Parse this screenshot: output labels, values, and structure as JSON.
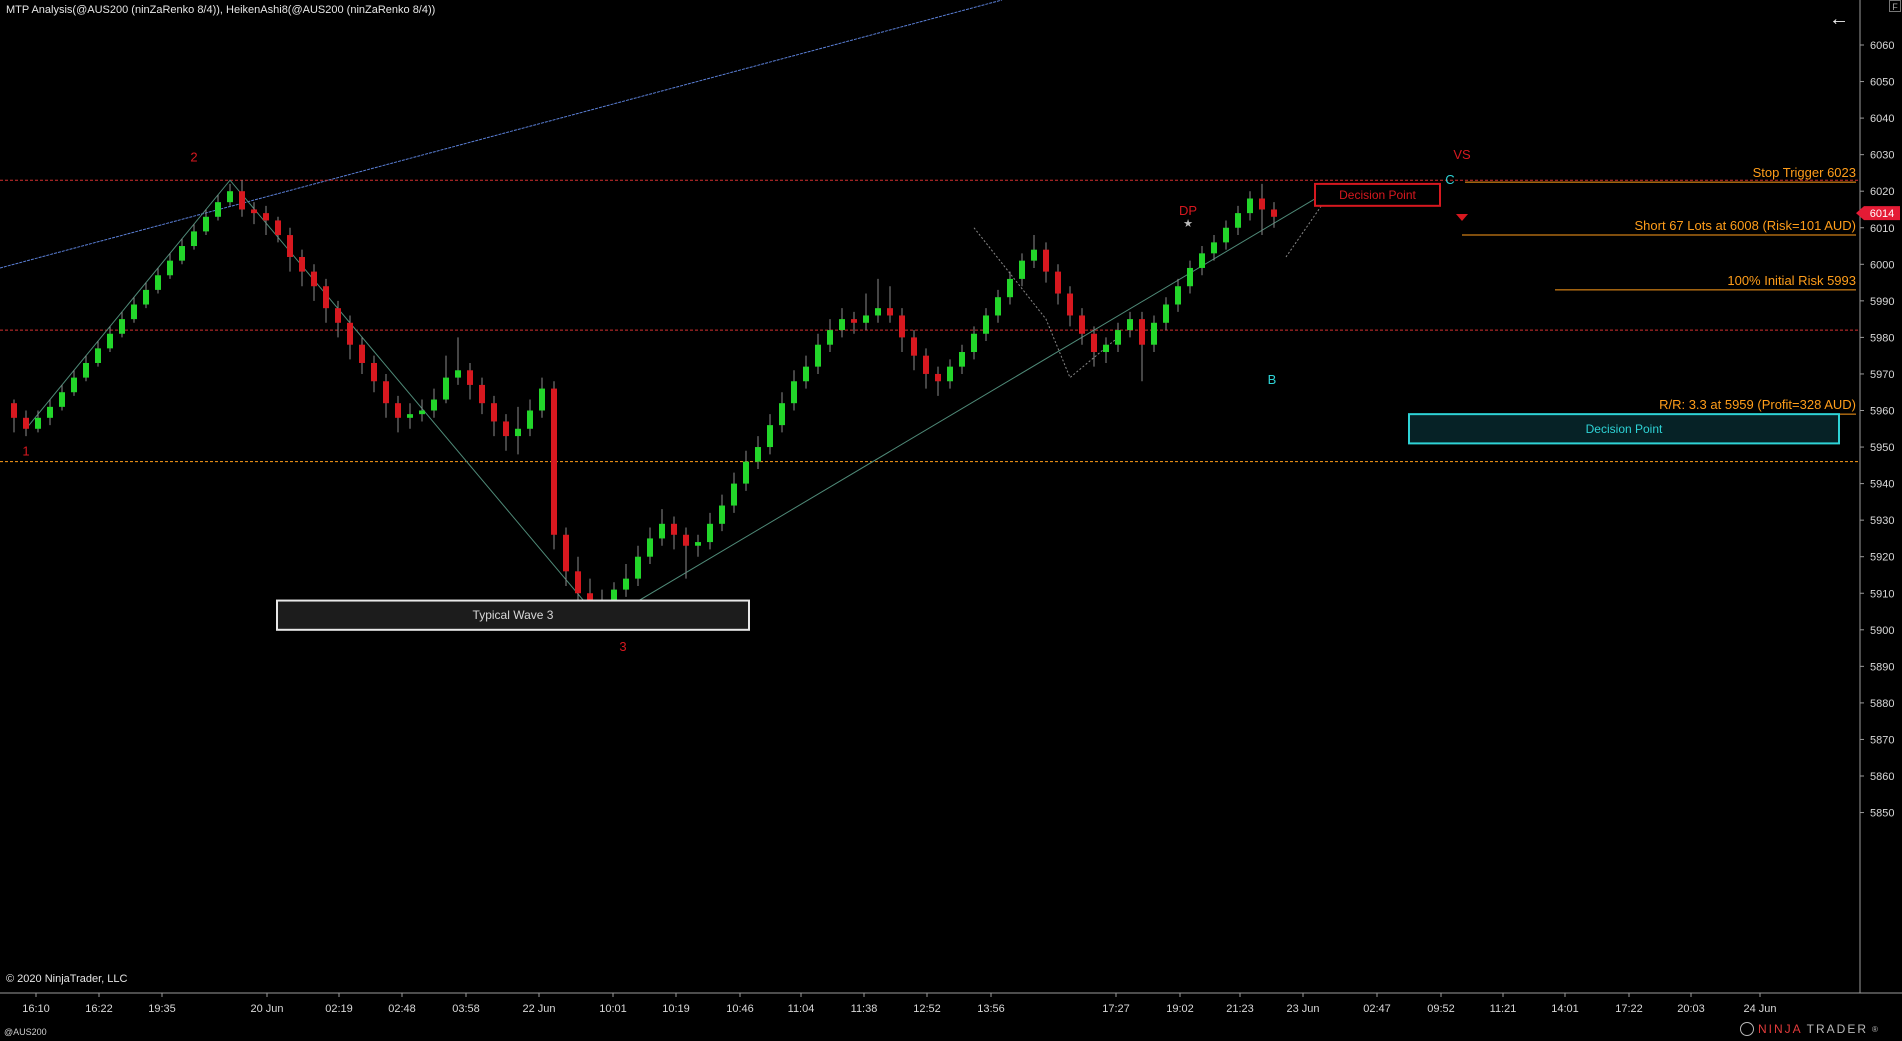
{
  "window": {
    "title": "MTP Analysis(@AUS200 (ninZaRenko 8/4)), HeikenAshi8(@AUS200 (ninZaRenko 8/4))",
    "copyright": "© 2020 NinjaTrader, LLC",
    "instrument": "@AUS200",
    "brand_prefix": "NINJA",
    "brand_suffix": "TRADER",
    "brand_mark": "®",
    "back_icon": "arrow-left-icon",
    "corner_label": "F"
  },
  "colors": {
    "background": "#000000",
    "bull": "#22d62a",
    "bear": "#d7181f",
    "wick": "#8a8a8a",
    "orange": "#ff9d1a",
    "dashed_red": "#d33030",
    "dashed_orange": "#ff9d1a",
    "trendline_blue": "#5a7fd6",
    "wave_line": "#4f8a78",
    "cyan": "#2ed3d6",
    "price_tag": "#e51b35"
  },
  "chart_data": {
    "type": "candlestick",
    "y_axis": {
      "min": 5850,
      "max": 6060,
      "ticks": [
        6060,
        6050,
        6040,
        6030,
        6020,
        6010,
        6000,
        5990,
        5980,
        5970,
        5960,
        5950,
        5940,
        5930,
        5920,
        5910,
        5900,
        5890,
        5880,
        5870,
        5860,
        5850
      ]
    },
    "x_ticks": [
      "16:10",
      "16:22",
      "19:35",
      "20 Jun",
      "02:19",
      "02:48",
      "03:58",
      "22 Jun",
      "10:01",
      "10:19",
      "10:46",
      "11:04",
      "11:38",
      "12:52",
      "13:56",
      "17:27",
      "19:02",
      "21:23",
      "23 Jun",
      "02:47",
      "09:52",
      "11:21",
      "14:01",
      "17:22",
      "20:03",
      "24 Jun"
    ],
    "last_price": "6014",
    "candles": [
      [
        5962,
        5958,
        5963,
        5954
      ],
      [
        5958,
        5955,
        5960,
        5953
      ],
      [
        5955,
        5958,
        5960,
        5954
      ],
      [
        5958,
        5961,
        5963,
        5956
      ],
      [
        5961,
        5965,
        5967,
        5960
      ],
      [
        5965,
        5969,
        5971,
        5964
      ],
      [
        5969,
        5973,
        5975,
        5968
      ],
      [
        5973,
        5977,
        5979,
        5972
      ],
      [
        5977,
        5981,
        5983,
        5976
      ],
      [
        5981,
        5985,
        5987,
        5980
      ],
      [
        5985,
        5989,
        5991,
        5984
      ],
      [
        5989,
        5993,
        5995,
        5988
      ],
      [
        5993,
        5997,
        5999,
        5992
      ],
      [
        5997,
        6001,
        6003,
        5996
      ],
      [
        6001,
        6005,
        6007,
        6000
      ],
      [
        6005,
        6009,
        6011,
        6004
      ],
      [
        6009,
        6013,
        6015,
        6008
      ],
      [
        6013,
        6017,
        6019,
        6012
      ],
      [
        6017,
        6020,
        6022,
        6016
      ],
      [
        6020,
        6015,
        6023,
        6013
      ],
      [
        6015,
        6014,
        6017,
        6011
      ],
      [
        6014,
        6012,
        6016,
        6008
      ],
      [
        6012,
        6008,
        6013,
        6006
      ],
      [
        6008,
        6002,
        6010,
        5998
      ],
      [
        6002,
        5998,
        6004,
        5994
      ],
      [
        5998,
        5994,
        6000,
        5990
      ],
      [
        5994,
        5988,
        5996,
        5984
      ],
      [
        5988,
        5984,
        5990,
        5980
      ],
      [
        5984,
        5978,
        5986,
        5974
      ],
      [
        5978,
        5973,
        5980,
        5970
      ],
      [
        5973,
        5968,
        5975,
        5965
      ],
      [
        5968,
        5962,
        5970,
        5958
      ],
      [
        5962,
        5958,
        5964,
        5954
      ],
      [
        5958,
        5959,
        5962,
        5955
      ],
      [
        5959,
        5960,
        5963,
        5957
      ],
      [
        5960,
        5963,
        5966,
        5958
      ],
      [
        5963,
        5969,
        5975,
        5962
      ],
      [
        5969,
        5971,
        5980,
        5967
      ],
      [
        5971,
        5967,
        5973,
        5963
      ],
      [
        5967,
        5962,
        5969,
        5959
      ],
      [
        5962,
        5957,
        5964,
        5953
      ],
      [
        5957,
        5953,
        5959,
        5949
      ],
      [
        5953,
        5955,
        5961,
        5948
      ],
      [
        5955,
        5960,
        5963,
        5953
      ],
      [
        5960,
        5966,
        5969,
        5958
      ],
      [
        5966,
        5926,
        5968,
        5922
      ],
      [
        5926,
        5916,
        5928,
        5912
      ],
      [
        5916,
        5910,
        5920,
        5906
      ],
      [
        5910,
        5906,
        5914,
        5902
      ],
      [
        5906,
        5908,
        5911,
        5903
      ],
      [
        5908,
        5911,
        5913,
        5906
      ],
      [
        5911,
        5914,
        5918,
        5909
      ],
      [
        5914,
        5920,
        5923,
        5912
      ],
      [
        5920,
        5925,
        5928,
        5918
      ],
      [
        5925,
        5929,
        5933,
        5923
      ],
      [
        5929,
        5926,
        5931,
        5922
      ],
      [
        5926,
        5923,
        5928,
        5914
      ],
      [
        5923,
        5924,
        5926,
        5920
      ],
      [
        5924,
        5929,
        5932,
        5922
      ],
      [
        5929,
        5934,
        5937,
        5927
      ],
      [
        5934,
        5940,
        5943,
        5932
      ],
      [
        5940,
        5946,
        5949,
        5938
      ],
      [
        5946,
        5950,
        5953,
        5944
      ],
      [
        5950,
        5956,
        5959,
        5948
      ],
      [
        5956,
        5962,
        5965,
        5954
      ],
      [
        5962,
        5968,
        5971,
        5960
      ],
      [
        5968,
        5972,
        5975,
        5966
      ],
      [
        5972,
        5978,
        5981,
        5970
      ],
      [
        5978,
        5982,
        5985,
        5976
      ],
      [
        5982,
        5985,
        5988,
        5980
      ],
      [
        5985,
        5984,
        5987,
        5981
      ],
      [
        5984,
        5986,
        5992,
        5982
      ],
      [
        5986,
        5988,
        5996,
        5984
      ],
      [
        5988,
        5986,
        5994,
        5984
      ],
      [
        5986,
        5980,
        5988,
        5976
      ],
      [
        5980,
        5975,
        5982,
        5971
      ],
      [
        5975,
        5970,
        5977,
        5966
      ],
      [
        5970,
        5968,
        5972,
        5964
      ],
      [
        5968,
        5972,
        5974,
        5966
      ],
      [
        5972,
        5976,
        5978,
        5970
      ],
      [
        5976,
        5981,
        5983,
        5974
      ],
      [
        5981,
        5986,
        5988,
        5979
      ],
      [
        5986,
        5991,
        5993,
        5984
      ],
      [
        5991,
        5996,
        5998,
        5989
      ],
      [
        5996,
        6001,
        6003,
        5994
      ],
      [
        6001,
        6004,
        6008,
        5999
      ],
      [
        6004,
        5998,
        6006,
        5995
      ],
      [
        5998,
        5992,
        6000,
        5989
      ],
      [
        5992,
        5986,
        5994,
        5983
      ],
      [
        5986,
        5981,
        5988,
        5978
      ],
      [
        5981,
        5976,
        5983,
        5972
      ],
      [
        5976,
        5978,
        5980,
        5973
      ],
      [
        5978,
        5982,
        5984,
        5976
      ],
      [
        5982,
        5985,
        5987,
        5980
      ],
      [
        5985,
        5978,
        5987,
        5968
      ],
      [
        5978,
        5984,
        5986,
        5976
      ],
      [
        5984,
        5989,
        5991,
        5982
      ],
      [
        5989,
        5994,
        5996,
        5987
      ],
      [
        5994,
        5999,
        6001,
        5992
      ],
      [
        5999,
        6003,
        6005,
        5997
      ],
      [
        6003,
        6006,
        6008,
        6001
      ],
      [
        6006,
        6010,
        6012,
        6004
      ],
      [
        6010,
        6014,
        6016,
        6008
      ],
      [
        6014,
        6018,
        6020,
        6012
      ],
      [
        6018,
        6015,
        6022,
        6008
      ],
      [
        6015,
        6013,
        6017,
        6010
      ]
    ],
    "horizontal_levels": [
      {
        "price": 6023,
        "style": "dashed-red"
      },
      {
        "price": 6022.5,
        "style": "solid-orange",
        "label": "Stop Trigger 6023"
      },
      {
        "price": 6008,
        "style": "solid-orange",
        "label": "Short 67 Lots at 6008 (Risk=101 AUD)"
      },
      {
        "price": 5993,
        "style": "solid-orange",
        "label": "100% Initial Risk 5993"
      },
      {
        "price": 5982,
        "style": "dashed-red"
      },
      {
        "price": 5959,
        "style": "solid-orange",
        "label": "R/R: 3.3 at 5959 (Profit=328 AUD)"
      },
      {
        "price": 5946,
        "style": "dashed-orange"
      }
    ],
    "annotations": {
      "wave_labels": [
        {
          "text": "1",
          "price": 5952
        },
        {
          "text": "2",
          "price": 6026
        },
        {
          "text": "3",
          "price": 5898
        }
      ],
      "pattern_labels": [
        {
          "text": "DP",
          "price": 6013
        },
        {
          "text": "B",
          "price": 5964
        },
        {
          "text": "C",
          "price": 6022
        },
        {
          "text": "VS",
          "price": 6025
        }
      ],
      "boxes": [
        {
          "text": "Typical Wave 3",
          "price_top": 5908,
          "price_bottom": 5900,
          "style": "gray"
        },
        {
          "text": "Decision Point",
          "price_top": 6022,
          "price_bottom": 6016,
          "style": "red"
        },
        {
          "text": "Decision Point",
          "price_top": 5959,
          "price_bottom": 5951,
          "style": "cyan"
        }
      ]
    }
  }
}
